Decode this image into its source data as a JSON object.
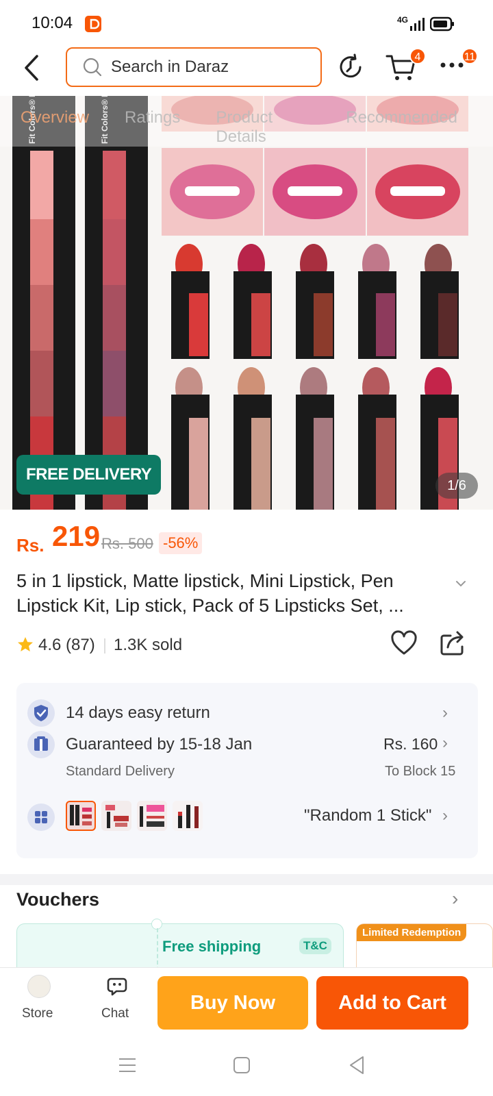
{
  "status": {
    "time": "10:04",
    "network": "4G"
  },
  "header": {
    "search_placeholder": "Search in Daraz",
    "cart_count": "4",
    "more_count": "11"
  },
  "hero": {
    "tabs": [
      "Overview",
      "Ratings",
      "Product Details",
      "Recommended"
    ],
    "brand_text": "Fit Colors® LIPSTICK",
    "free_delivery": "FREE DELIVERY",
    "counter": "1/6"
  },
  "price": {
    "currency": "Rs.",
    "amount": "219",
    "original": "Rs. 500",
    "discount": "-56%"
  },
  "product": {
    "title": "5 in 1 lipstick, Matte lipstick, Mini Lipstick, Pen Lipstick Kit, Lip stick, Pack of 5 Lipsticks Set, ...",
    "rating": "4.6",
    "reviews": "(87)",
    "sold": "1.3K sold"
  },
  "services": {
    "return_text": "14 days easy return",
    "guarantee_text": "Guaranteed by 15-18 Jan",
    "delivery_type": "Standard Delivery",
    "delivery_price": "Rs. 160",
    "delivery_to": "To Block 15",
    "variant_text": "\"Random 1 Stick\""
  },
  "vouchers": {
    "title": "Vouchers",
    "free_shipping": "Free shipping",
    "tc": "T&C",
    "limited": "Limited Redemption"
  },
  "bottom": {
    "store": "Store",
    "chat": "Chat",
    "buy_now": "Buy Now",
    "add_to_cart": "Add to Cart"
  },
  "colors": {
    "accent": "#f85606",
    "buy_now": "#ffa31a",
    "free_delivery": "#0e7a64"
  }
}
